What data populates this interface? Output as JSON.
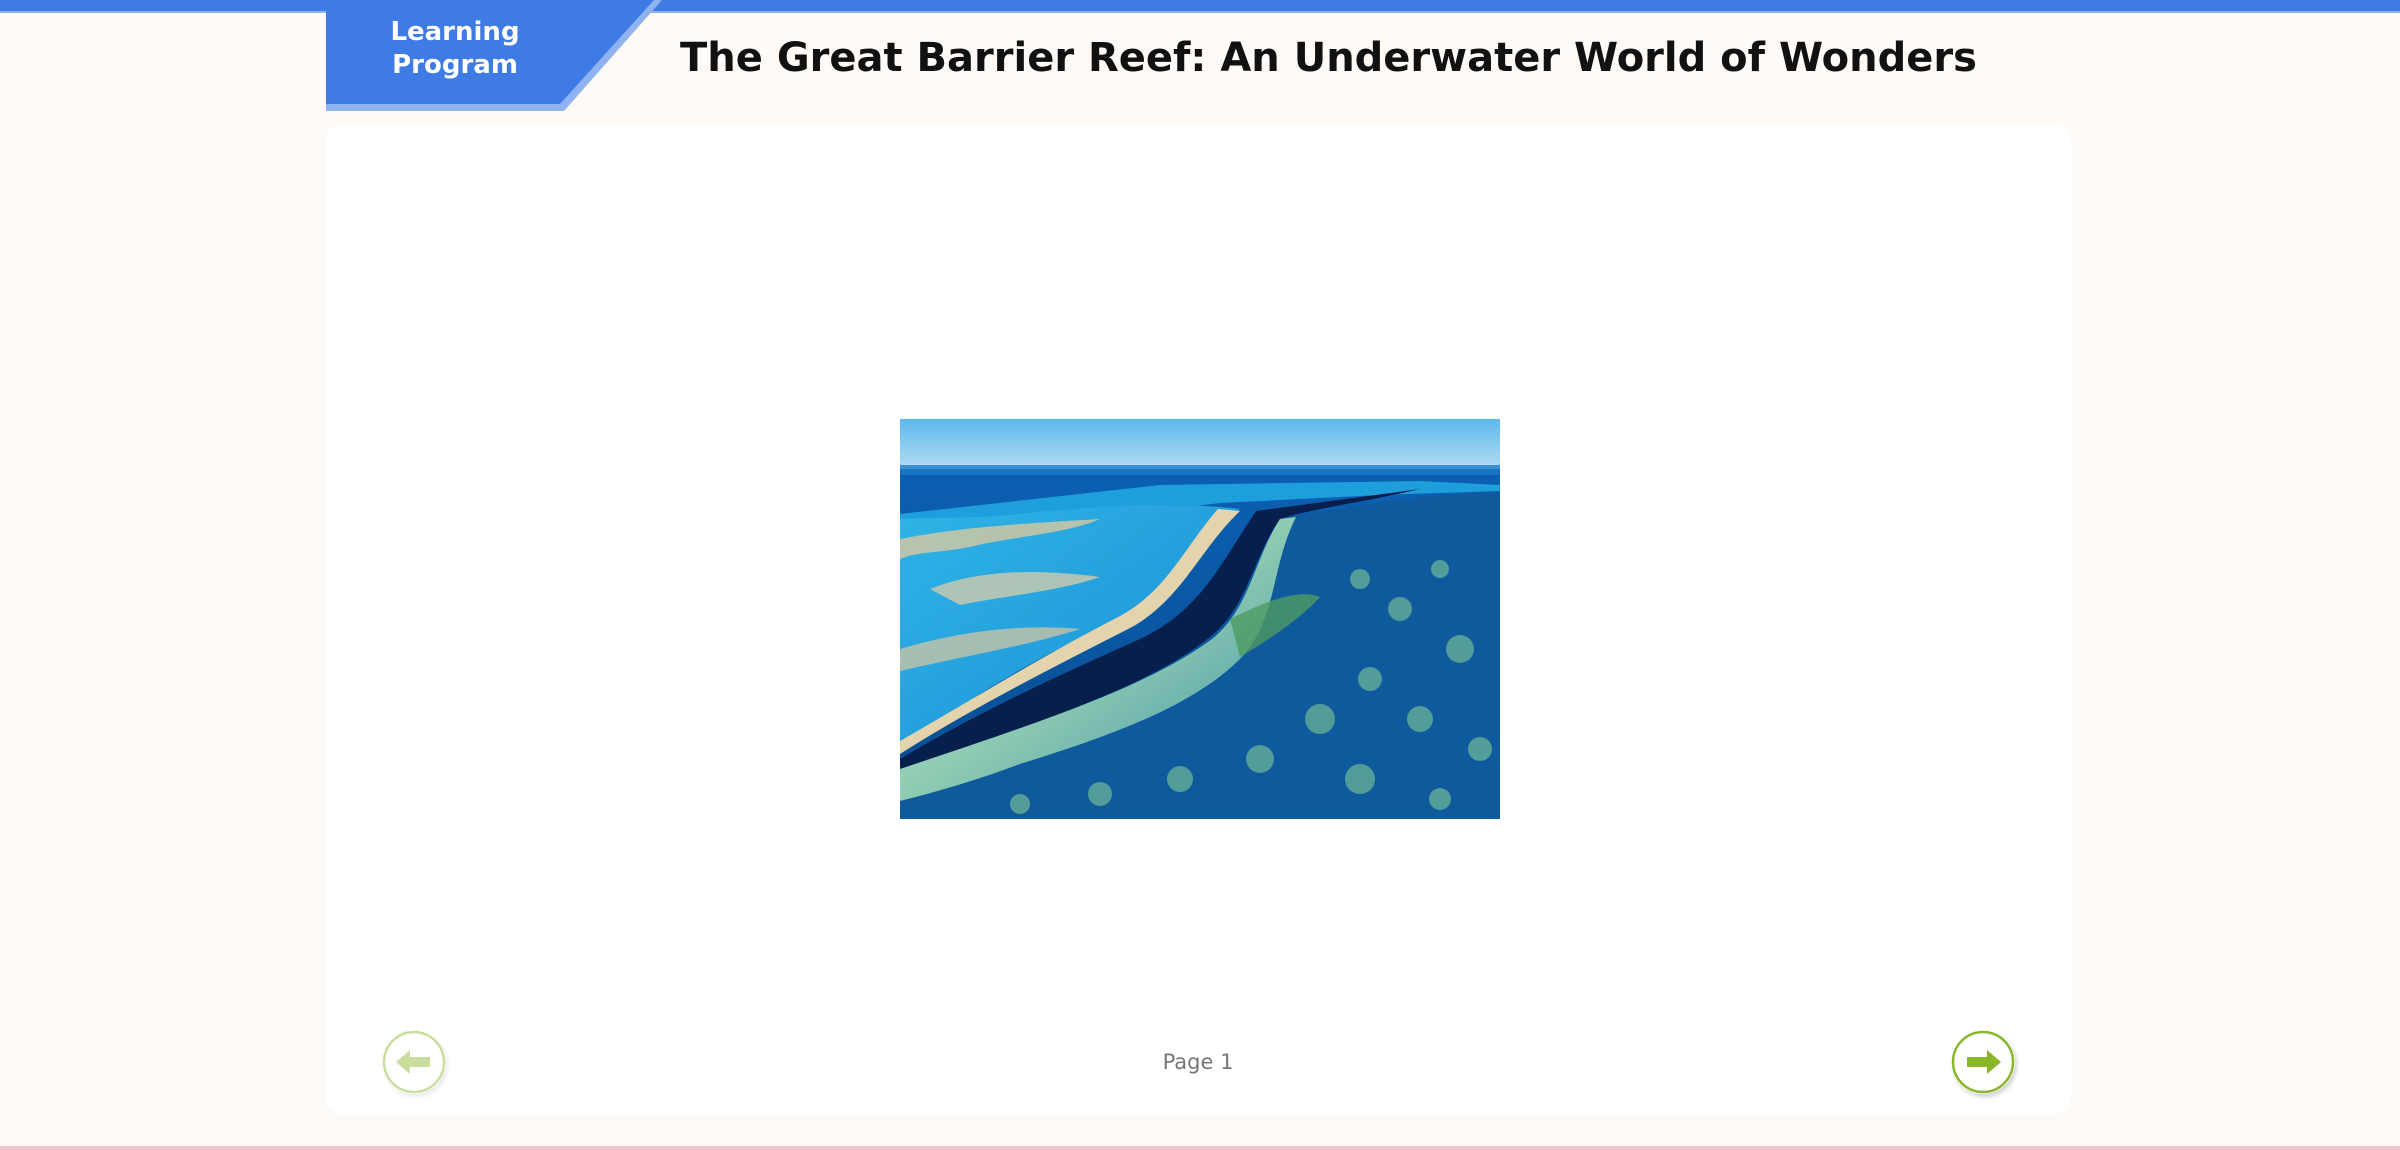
{
  "header": {
    "badge_label": "Learning\nProgram",
    "title": "The Great Barrier Reef: An Underwater World of Wonders"
  },
  "content": {
    "image": "aerial view of a coral reef with a deep blue channel",
    "page_label": "Page 1"
  },
  "navigation": {
    "prev_icon": "arrow-left-icon",
    "next_icon": "arrow-right-icon"
  },
  "colors": {
    "accent": "#3f7be4",
    "accent_light": "#8fb3f0",
    "nav_green": "#8ab62a",
    "background": "#fffaf5"
  }
}
